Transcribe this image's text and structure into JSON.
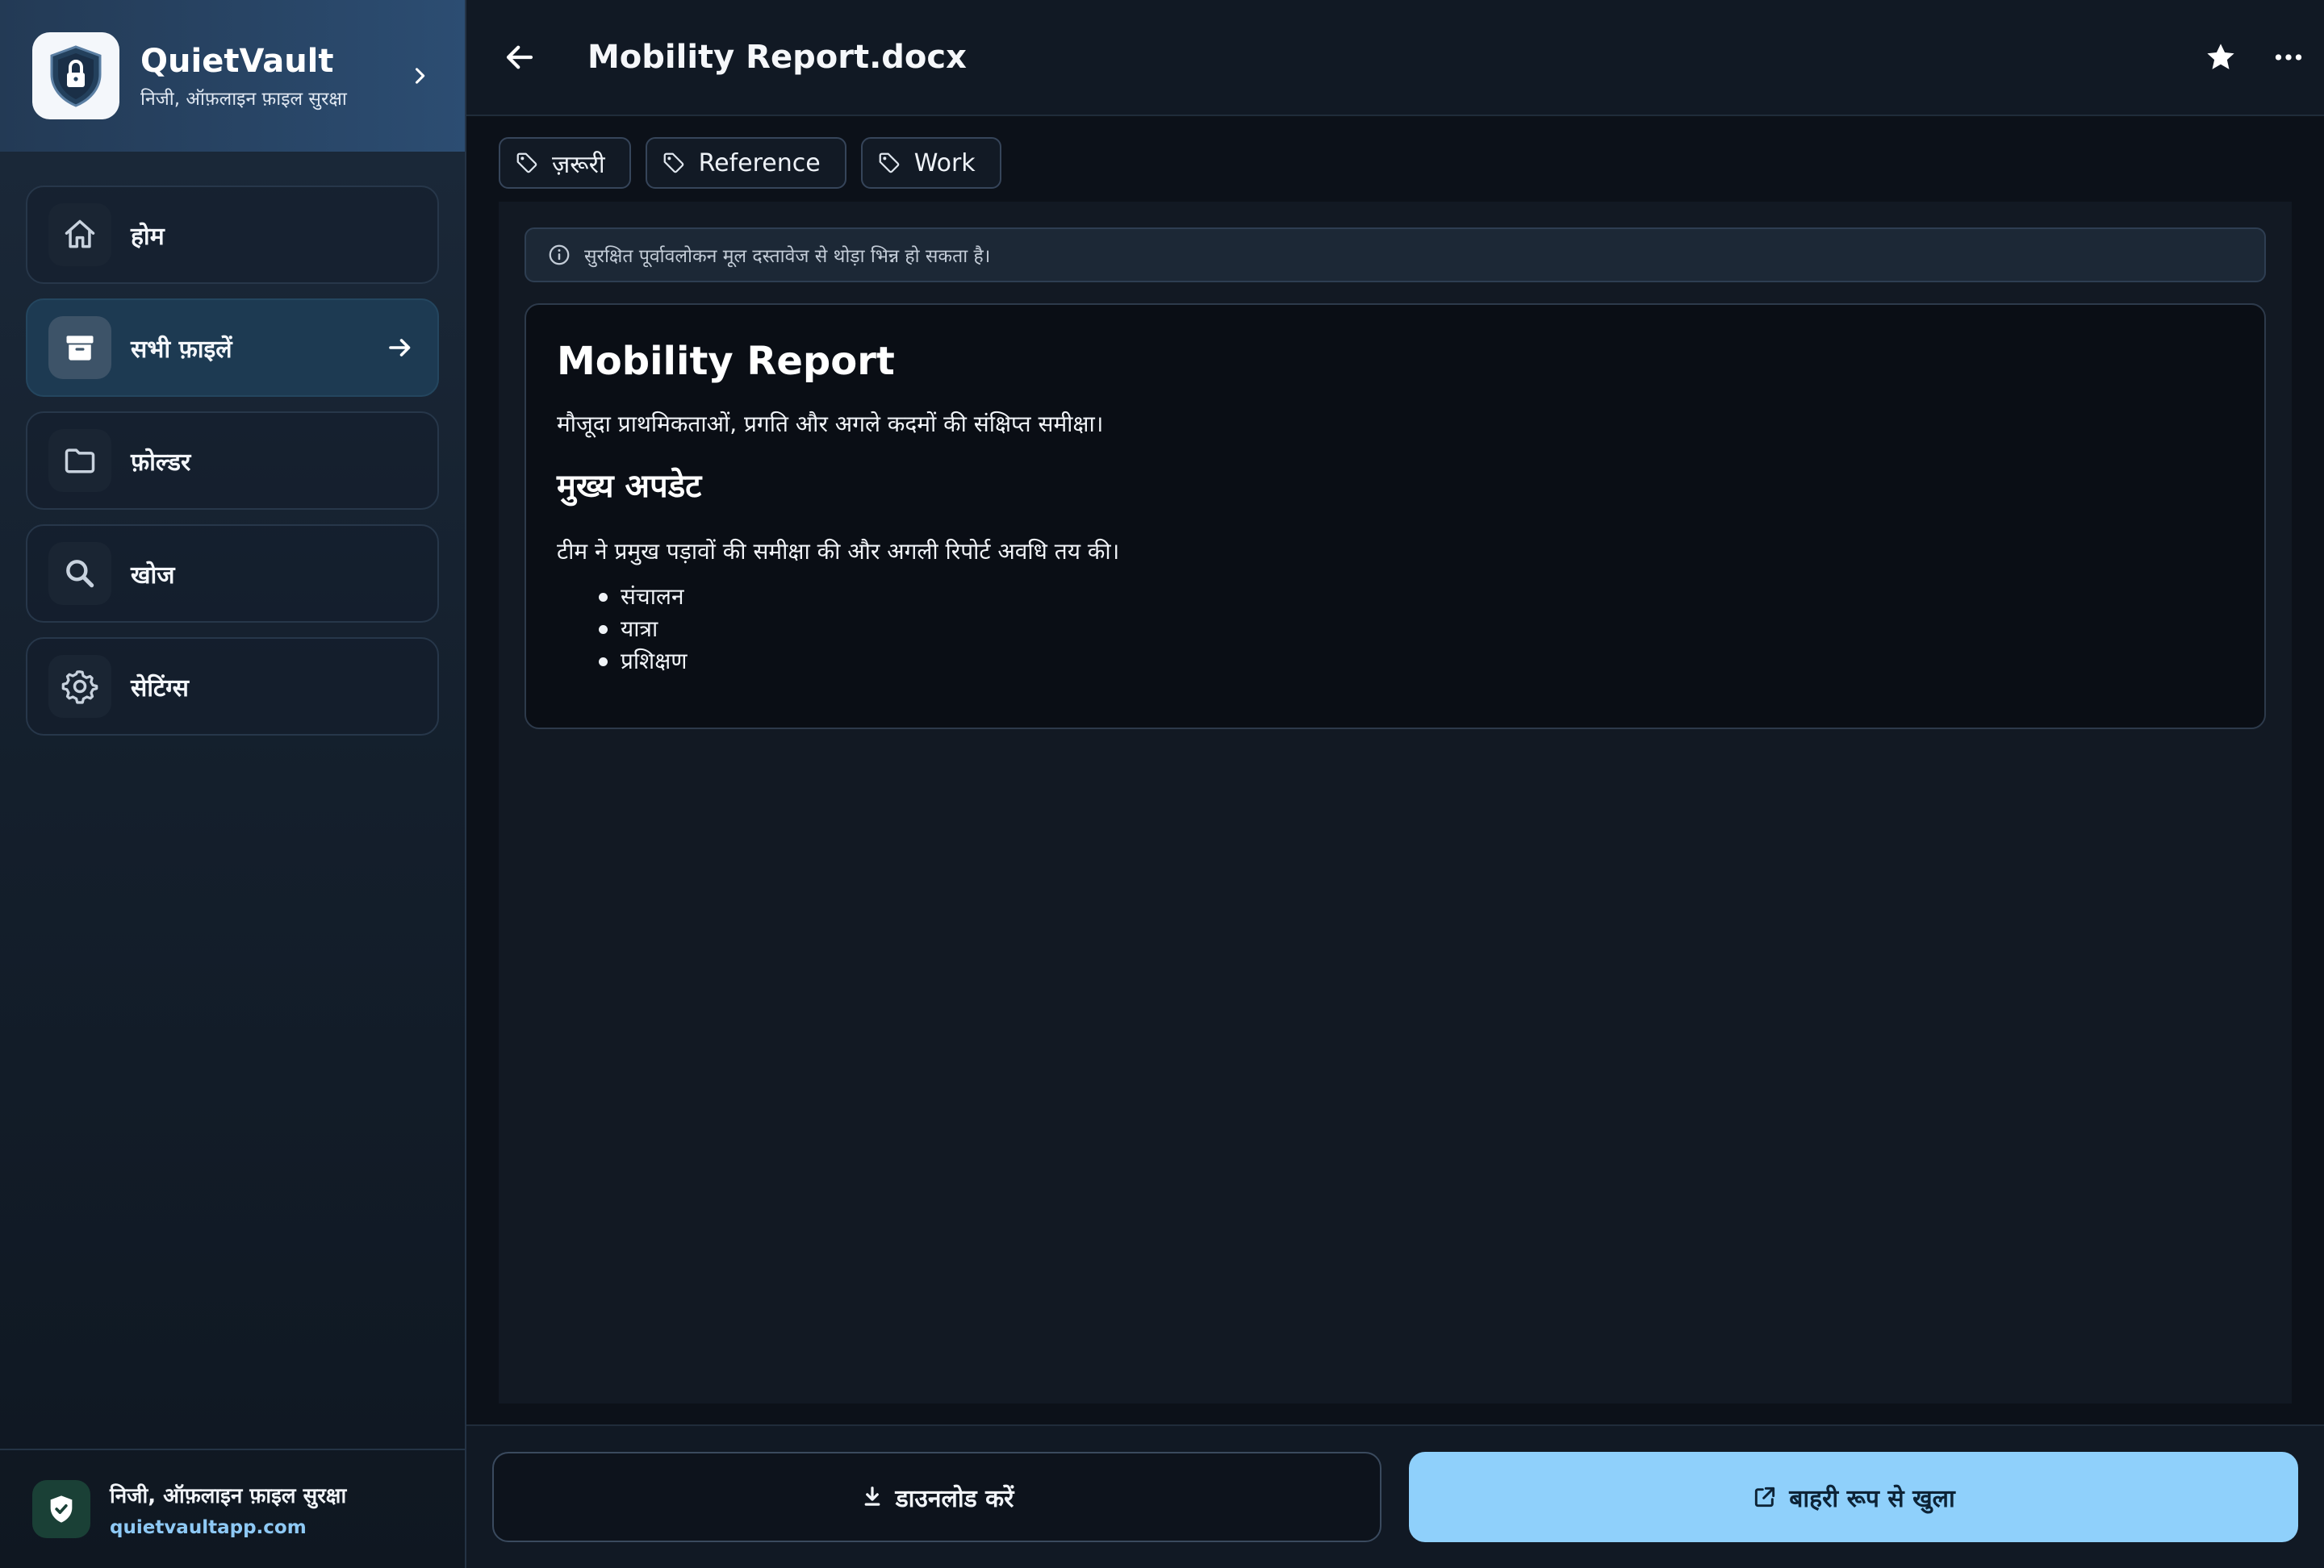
{
  "brand": {
    "title": "QuietVault",
    "subtitle": "निजी, ऑफ़लाइन फ़ाइल सुरक्षा"
  },
  "sidebar": {
    "items": [
      {
        "label": "होम",
        "icon": "home-icon",
        "active": false
      },
      {
        "label": "सभी फ़ाइलें",
        "icon": "archive-box-icon",
        "active": true
      },
      {
        "label": "फ़ोल्डर",
        "icon": "folder-icon",
        "active": false
      },
      {
        "label": "खोज",
        "icon": "search-icon",
        "active": false
      },
      {
        "label": "सेटिंग्स",
        "icon": "gear-icon",
        "active": false
      }
    ],
    "footer": {
      "title": "निजी, ऑफ़लाइन फ़ाइल सुरक्षा",
      "url": "quietvaultapp.com"
    }
  },
  "header": {
    "title": "Mobility Report.docx"
  },
  "tags": [
    {
      "label": "ज़रूरी"
    },
    {
      "label": "Reference"
    },
    {
      "label": "Work"
    }
  ],
  "preview": {
    "notice": "सुरक्षित पूर्वावलोकन मूल दस्तावेज से थोड़ा भिन्न हो सकता है।",
    "document": {
      "heading": "Mobility Report",
      "intro": "मौजूदा प्राथमिकताओं, प्रगति और अगले कदमों की संक्षिप्त समीक्षा।",
      "subheading": "मुख्य अपडेट",
      "body": "टीम ने प्रमुख पड़ावों की समीक्षा की और अगली रिपोर्ट अवधि तय की।",
      "bullets": [
        "संचालन",
        "यात्रा",
        "प्रशिक्षण"
      ]
    }
  },
  "actions": {
    "download_label": "डाउनलोड करें",
    "open_external_label": "बाहरी रूप से खुला"
  },
  "colors": {
    "accent": "#8fd0fb",
    "sidebar_active": "#1d3a52",
    "background": "#0c1119"
  }
}
